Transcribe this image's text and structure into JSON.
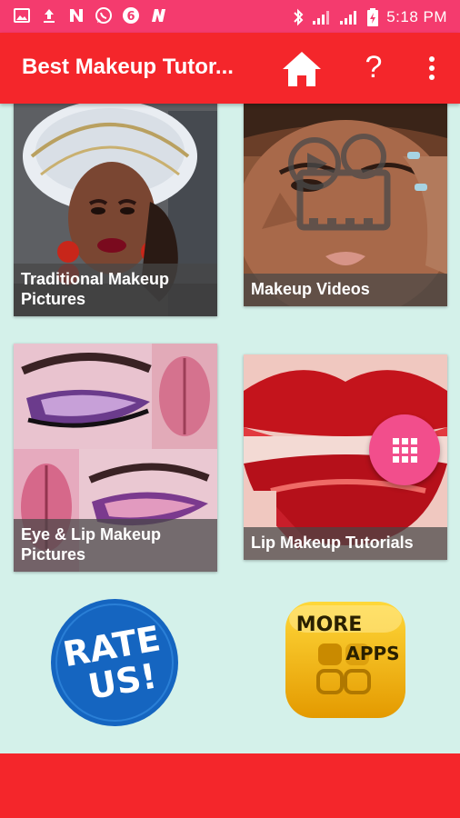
{
  "status_bar": {
    "time": "5:18 PM",
    "left_icons": [
      "image-icon",
      "upload-icon",
      "n-icon",
      "whatsapp-icon",
      "six-icon",
      "n-bold-icon"
    ],
    "right_icons": [
      "bluetooth-icon",
      "signal-icon",
      "signal-icon",
      "battery-icon"
    ]
  },
  "app_bar": {
    "title": "Best Makeup Tutor...",
    "help_label": "?",
    "icons": [
      "home-icon",
      "help-icon",
      "more-vert-icon"
    ]
  },
  "tiles": [
    {
      "label": "Traditional Makeup Pictures"
    },
    {
      "label": "Makeup Videos"
    },
    {
      "label": "Eye & Lip Makeup Pictures"
    },
    {
      "label": "Lip Makeup Tutorials"
    }
  ],
  "rate_us": {
    "line1": "RATE",
    "line2": "US!"
  },
  "more_apps": {
    "line1": "MORE",
    "line2": "APPS"
  },
  "fab_icon": "apps-grid-icon",
  "colors": {
    "status_bar": "#f43b6e",
    "app_bar": "#f4262b",
    "background": "#d4f1ea",
    "fab": "#f24e8c",
    "rate_badge": "#1565c0",
    "more_apps_badge": "#f5b800"
  }
}
